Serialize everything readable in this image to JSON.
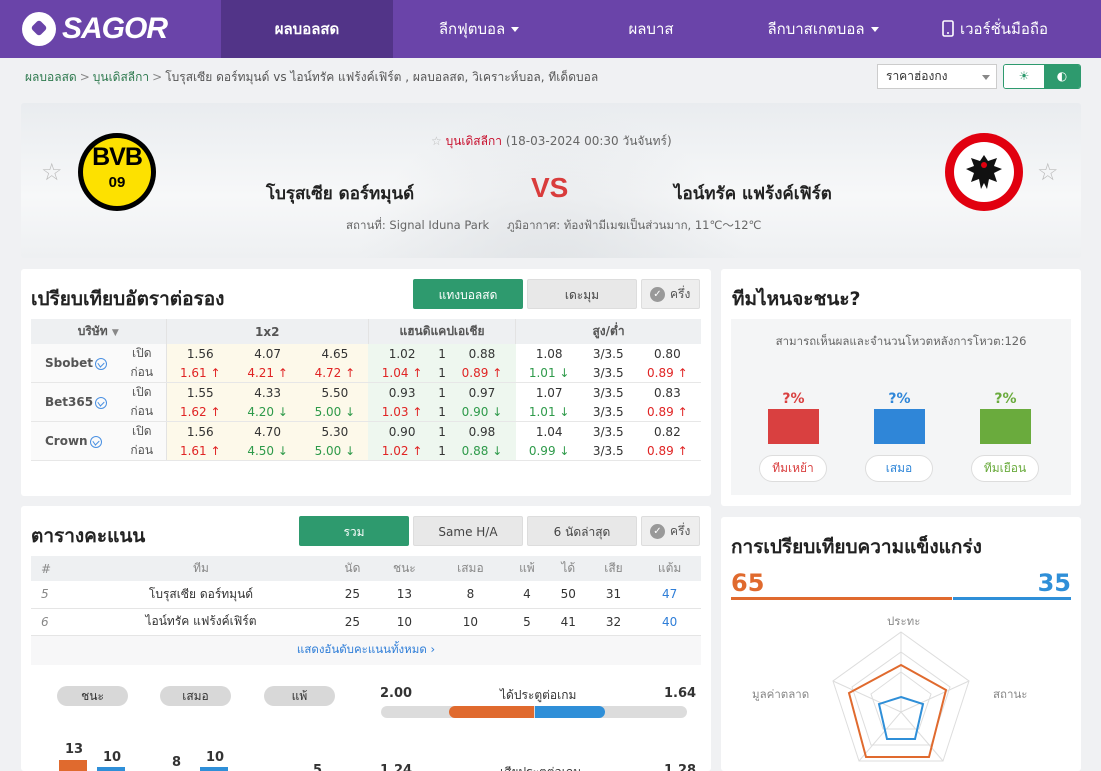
{
  "brand": {
    "name": "SAGOR"
  },
  "nav": {
    "items": [
      {
        "label": "ผลบอลสด",
        "active": true
      },
      {
        "label": "ลีกฟุตบอล",
        "caret": true
      },
      {
        "label": "ผลบาส"
      },
      {
        "label": "ลีกบาสเกตบอล",
        "caret": true
      },
      {
        "label": "เวอร์ชั่นมือถือ",
        "icon": "mobile-icon"
      }
    ]
  },
  "breadcrumb": {
    "home": "ผลบอลสด",
    "league": "บุนเดิสลีกา",
    "current": "โบรุสเซีย ดอร์ทมุนด์ vs  ไอน์ทรัค แฟร้งค์เฟิร์ต ,  ผลบอลสด,  วิเคราะห์บอล,  ทีเด็ดบอล"
  },
  "odds_format": "ราคาฮ่องกง",
  "match": {
    "league": "บุนเดิสลีกา",
    "datetime": "(18-03-2024 00:30 วันจันทร์)",
    "home": "โบรุสเซีย ดอร์ทมุนด์",
    "away": "ไอน์ทรัค แฟร้งค์เฟิร์ต",
    "vs": "VS",
    "venue": "สถานที่: Signal Iduna Park",
    "weather": "ภูมิอากาศ: ท้องฟ้ามีเมฆเป็นส่วนมาก, 11℃～12℃",
    "home_logo": {
      "line1": "BVB",
      "line2": "09"
    }
  },
  "odds": {
    "title": "เปรียบเทียบอัตราต่อรอง",
    "tab_live": "แทงบอลสด",
    "tab_early": "เดะมุม",
    "half": "ครึ่ง",
    "headers": [
      "บริษัท",
      "1x2",
      "แฮนดิแคปเอเชีย",
      "สูง/ต่ำ"
    ],
    "open": "เปิด",
    "before": "ก่อน",
    "rows": [
      {
        "company": "Sbobet",
        "open": [
          "1.56",
          "4.07",
          "4.65",
          "1.02",
          "1",
          "0.88",
          "1.08",
          "3/3.5",
          "0.80"
        ],
        "cur": [
          "1.61",
          "4.21",
          "4.72",
          "1.04",
          "1",
          "0.89",
          "1.01",
          "3/3.5",
          "0.89"
        ],
        "dir": [
          "up",
          "up",
          "up",
          "up",
          "",
          "up",
          "dn",
          "",
          "up"
        ]
      },
      {
        "company": "Bet365",
        "open": [
          "1.55",
          "4.33",
          "5.50",
          "0.93",
          "1",
          "0.97",
          "1.07",
          "3/3.5",
          "0.83"
        ],
        "cur": [
          "1.62",
          "4.20",
          "5.00",
          "1.03",
          "1",
          "0.90",
          "1.01",
          "3/3.5",
          "0.89"
        ],
        "dir": [
          "up",
          "dn",
          "dn",
          "up",
          "",
          "dn",
          "dn",
          "",
          "up"
        ]
      },
      {
        "company": "Crown",
        "open": [
          "1.56",
          "4.70",
          "5.30",
          "0.90",
          "1",
          "0.98",
          "1.04",
          "3/3.5",
          "0.82"
        ],
        "cur": [
          "1.61",
          "4.50",
          "5.00",
          "1.02",
          "1",
          "0.88",
          "0.99",
          "3/3.5",
          "0.89"
        ],
        "dir": [
          "up",
          "dn",
          "dn",
          "up",
          "",
          "dn",
          "dn",
          "",
          "up"
        ]
      }
    ]
  },
  "vote": {
    "title": "ทีมไหนจะชนะ?",
    "note": "สามารถเห็นผลและจำนวนโหวตหลังการโหวต:126",
    "options": [
      {
        "pct": "?%",
        "label": "ทีมเหย้า",
        "color": "#d94040"
      },
      {
        "pct": "?%",
        "label": "เสมอ",
        "color": "#2f86d8"
      },
      {
        "pct": "?%",
        "label": "ทีมเยือน",
        "color": "#6aab3d"
      }
    ]
  },
  "standings": {
    "title": "ตารางคะแนน",
    "tab_all": "รวม",
    "tab_ha": "Same H/A",
    "tab_last6": "6 นัดล่าสุด",
    "half": "ครึ่ง",
    "headers": [
      "#",
      "ทีม",
      "นัด",
      "ชนะ",
      "เสมอ",
      "แพ้",
      "ได้",
      "เสีย",
      "แต้ม"
    ],
    "rows": [
      [
        "5",
        "โบรุสเซีย ดอร์ทมุนด์",
        "25",
        "13",
        "8",
        "4",
        "50",
        "31",
        "47"
      ],
      [
        "6",
        "ไอน์ทรัค แฟร้งค์เฟิร์ต",
        "25",
        "10",
        "10",
        "5",
        "41",
        "32",
        "40"
      ]
    ],
    "show_all": "แสดงอันดับคะแนนทั้งหมด"
  },
  "summary": {
    "win": "ชนะ",
    "draw": "เสมอ",
    "loss": "แพ้",
    "goals_label": "ได้ประตูต่อเกม",
    "home_goals": "2.00",
    "away_goals": "1.64",
    "home_goal_share": 0.55,
    "bars": [
      {
        "a": "13",
        "b": "10"
      },
      {
        "a": "8",
        "b": "10"
      },
      {
        "a": "",
        "b": "5"
      }
    ],
    "row2_home": "1.24",
    "row2_away": "1.28",
    "row2_label": "เสียประตูต่อเกม"
  },
  "strength": {
    "title": "การเปรียบเทียบความแข็งแกร่ง",
    "home": "65",
    "away": "35",
    "home_color": "#e06a2e",
    "away_color": "#2f8fd8",
    "axes": [
      "ประทะ",
      "สถานะ",
      "มูลค่าตลาด"
    ]
  }
}
